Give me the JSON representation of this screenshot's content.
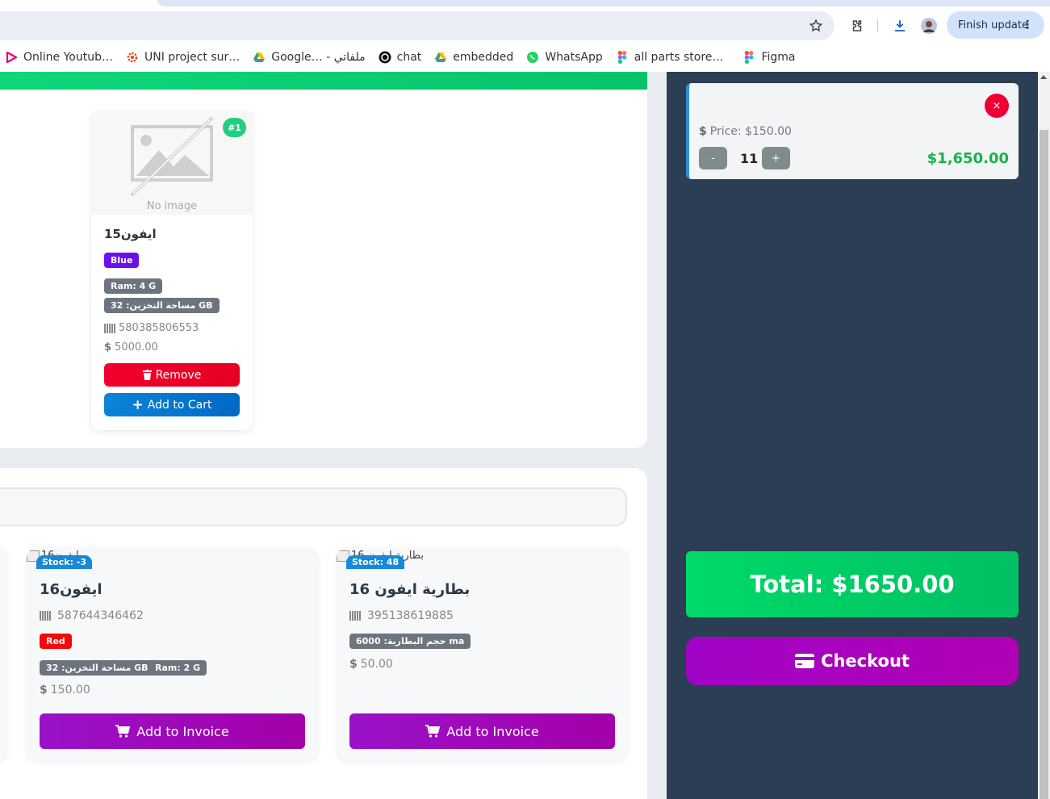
{
  "browser": {
    "finish_update_label": "Finish update",
    "bookmarks": [
      {
        "label": "Online Youtub…",
        "icon": "play-logo-icon"
      },
      {
        "label": "UNI project sur…",
        "icon": "gear-logo-icon"
      },
      {
        "label": "Google… - ملفاتي",
        "icon": "google-drive-icon"
      },
      {
        "label": "chat",
        "icon": "chatgpt-icon"
      },
      {
        "label": "embedded",
        "icon": "google-drive-icon"
      },
      {
        "label": "WhatsApp",
        "icon": "whatsapp-icon"
      },
      {
        "label": "all parts store…",
        "icon": "figma-icon"
      },
      {
        "label": "Figma",
        "icon": "figma-icon"
      }
    ]
  },
  "product_card": {
    "rank_badge": "#1",
    "no_image_text": "No image",
    "name": "ايفون15",
    "color_badge": "Blue",
    "ram_badge": "Ram: 4 G",
    "storage_badge": "مساحة التخزين: 32 GB",
    "barcode": "580385806553",
    "price": "5000.00",
    "remove_label": "Remove",
    "add_to_cart_label": "Add to Cart"
  },
  "inventory": [
    {
      "alt_text": "ايفون16",
      "stock": "Stock: -3",
      "name": "ايفون16",
      "barcode": "587644346462",
      "color_badge": "Red",
      "storage_badge": "مساحة التخزين: 32 GB",
      "ram_badge": "Ram: 2 G",
      "price": "150.00",
      "button_label": "Add to Invoice"
    },
    {
      "alt_text": "بطارية ايفون 16",
      "stock": "Stock: 48",
      "name": "بطارية ايفون 16",
      "barcode": "395138619885",
      "capacity_badge": "حجم البطارية: 6000 ma",
      "price": "50.00",
      "button_label": "Add to Invoice"
    }
  ],
  "cart": {
    "close_symbol": "×",
    "price_label": "Price: $150.00",
    "minus_label": "-",
    "quantity": "11",
    "plus_label": "+",
    "line_total": "$1,650.00"
  },
  "total_label": "Total: $1650.00",
  "checkout_label": "Checkout",
  "colors": {
    "accent_green": "#00d969",
    "checkout_purple": "#a004c6",
    "sidebar_bg": "#2c3e53",
    "remove_red": "#f0002e",
    "cart_blue": "#0a84d8"
  }
}
